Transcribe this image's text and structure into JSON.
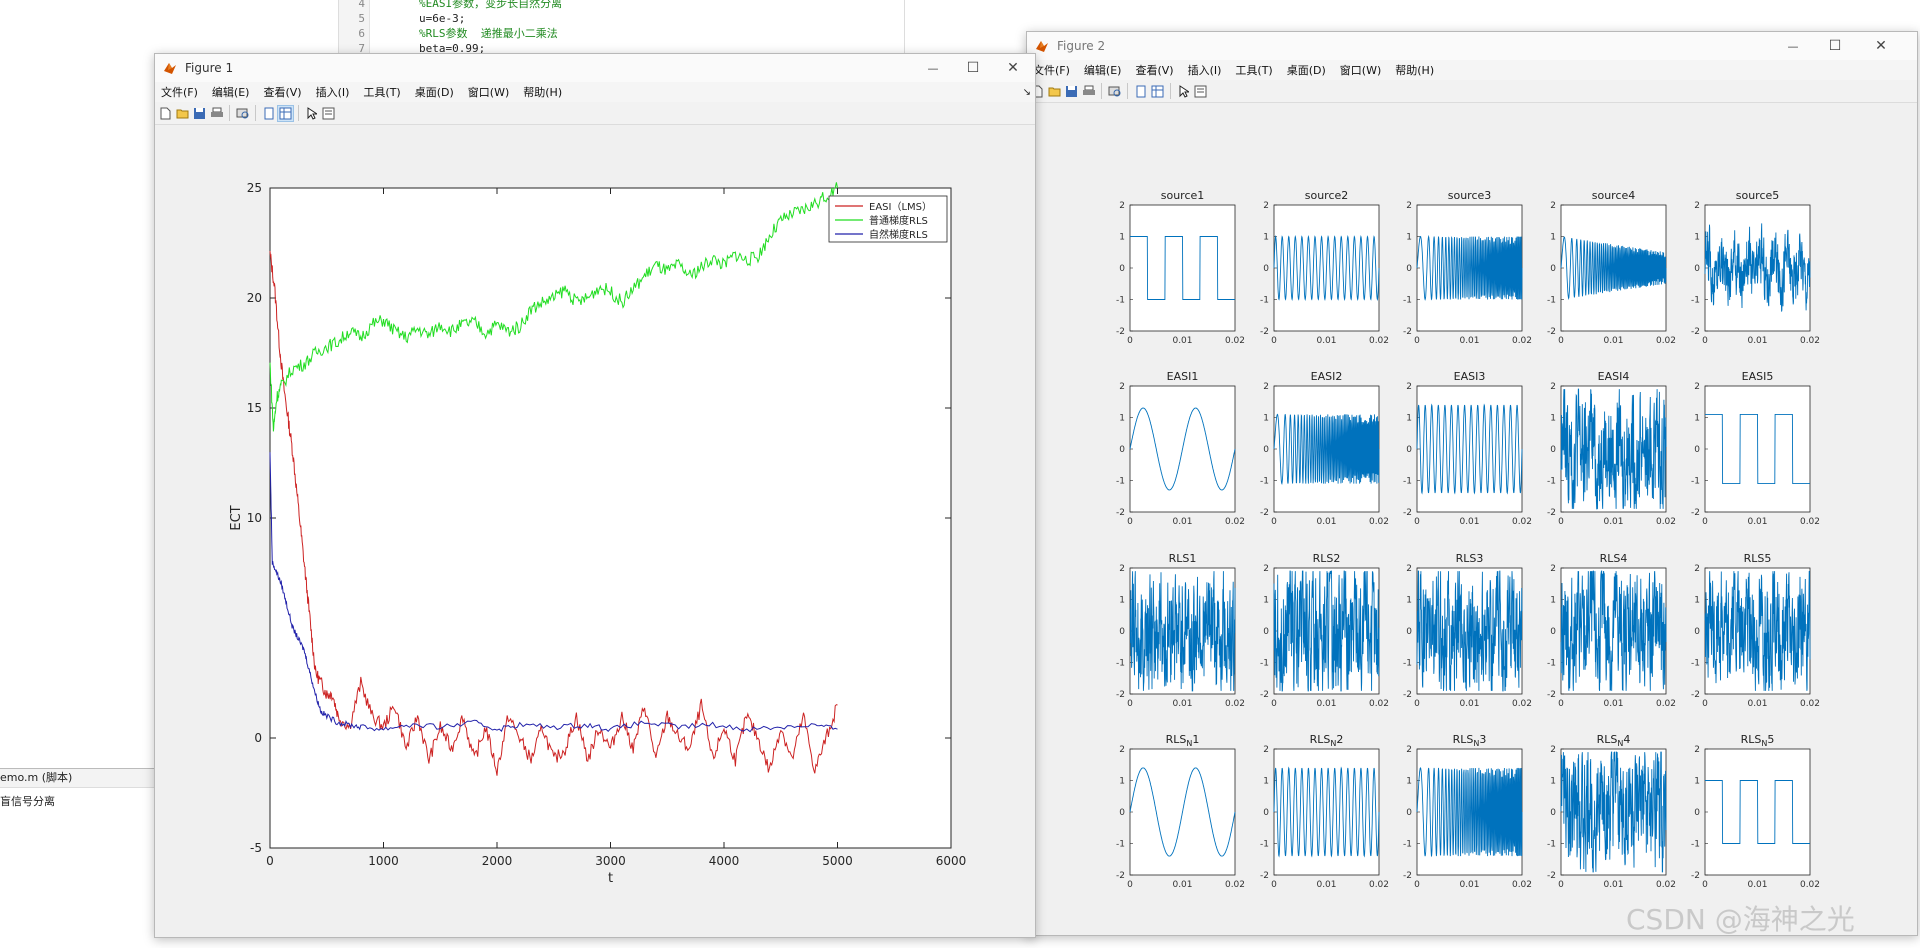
{
  "editor": {
    "lines": [
      {
        "num": "4",
        "text": "%EASI参数，变步长自然分离",
        "comment": true
      },
      {
        "num": "5",
        "text": "u=6e-3;",
        "comment": false
      },
      {
        "num": "6",
        "text": "%RLS参数  递推最小二乘法",
        "comment": true
      },
      {
        "num": "7",
        "text": "beta=0.99;",
        "comment": false
      }
    ]
  },
  "bg_script": {
    "tab_label": "emo.m  (脚本)",
    "text": "盲信号分离"
  },
  "figure1": {
    "title": "Figure 1",
    "menu": [
      "文件(F)",
      "编辑(E)",
      "查看(V)",
      "插入(I)",
      "工具(T)",
      "桌面(D)",
      "窗口(W)",
      "帮助(H)"
    ],
    "close": "✕",
    "maximize": "☐",
    "minimize": "—"
  },
  "figure2": {
    "title": "Figure 2",
    "menu": [
      "文件(F)",
      "编辑(E)",
      "查看(V)",
      "插入(I)",
      "工具(T)",
      "桌面(D)",
      "窗口(W)",
      "帮助(H)"
    ],
    "close": "✕",
    "maximize": "☐",
    "minimize": "—"
  },
  "chart_data": [
    {
      "type": "line",
      "xlabel": "t",
      "ylabel": "ECT",
      "xlim": [
        0,
        6000
      ],
      "ylim": [
        -5,
        25
      ],
      "xticks": [
        0,
        1000,
        2000,
        3000,
        4000,
        5000,
        6000
      ],
      "yticks": [
        -5,
        0,
        10,
        15,
        20,
        25
      ],
      "legend_position": "top-right",
      "series": [
        {
          "name": "EASI（LMS）",
          "color": "#cc2222",
          "x": [
            0,
            40,
            80,
            120,
            160,
            200,
            240,
            280,
            320,
            360,
            400,
            450,
            500,
            550,
            600,
            700,
            800,
            900,
            1000,
            1100,
            1200,
            1300,
            1400,
            1500,
            1600,
            1700,
            1800,
            1900,
            2000,
            2100,
            2200,
            2300,
            2400,
            2500,
            2600,
            2700,
            2800,
            2900,
            3000,
            3100,
            3200,
            3300,
            3400,
            3500,
            3600,
            3700,
            3800,
            3900,
            4000,
            4100,
            4200,
            4300,
            4400,
            4500,
            4600,
            4700,
            4800,
            4900,
            5000
          ],
          "y": [
            22,
            20.5,
            18,
            16,
            14.5,
            13,
            11,
            9,
            7,
            5,
            3,
            2.5,
            2,
            2,
            1,
            0.5,
            2.5,
            1,
            0.5,
            1.5,
            -0.5,
            1,
            -1,
            0.5,
            -0.5,
            1,
            -1,
            0.5,
            -1.5,
            1,
            0,
            -1,
            0.5,
            -1,
            -0.5,
            1,
            -1,
            0.5,
            -0.5,
            1,
            -0.5,
            1.5,
            -1,
            1,
            0,
            -0.5,
            1.5,
            -1,
            0.5,
            -1,
            1,
            0,
            -1.5,
            0.5,
            -1,
            1,
            -1.5,
            0,
            1.5
          ]
        },
        {
          "name": "普通梯度RLS",
          "color": "#22dd22",
          "x": [
            0,
            30,
            60,
            100,
            200,
            300,
            400,
            500,
            600,
            700,
            800,
            900,
            1000,
            1100,
            1200,
            1300,
            1400,
            1500,
            1600,
            1700,
            1800,
            1900,
            2000,
            2100,
            2200,
            2300,
            2400,
            2500,
            2600,
            2700,
            2800,
            2900,
            3000,
            3100,
            3200,
            3300,
            3400,
            3500,
            3600,
            3700,
            3800,
            3900,
            4000,
            4100,
            4200,
            4300,
            4400,
            4500,
            4600,
            4700,
            4800,
            4900,
            5000
          ],
          "y": [
            17,
            14,
            15.5,
            16,
            16.8,
            17,
            17.5,
            17.8,
            18,
            18.5,
            18.2,
            18.8,
            19,
            18.5,
            18.2,
            18.6,
            18.3,
            18.8,
            18.5,
            18.8,
            18.9,
            18.4,
            18.8,
            18.5,
            18.7,
            19.5,
            19.8,
            20,
            20.4,
            19.8,
            20,
            20.5,
            20.3,
            19.8,
            20.4,
            21,
            21.5,
            21.2,
            21.5,
            21,
            21.4,
            21.8,
            21.5,
            22,
            21.7,
            21.9,
            22.8,
            23.5,
            23.8,
            24,
            24.3,
            24.6,
            25
          ]
        },
        {
          "name": "自然梯度RLS",
          "color": "#2222aa",
          "x": [
            0,
            20,
            60,
            100,
            150,
            200,
            250,
            300,
            350,
            400,
            450,
            500,
            600,
            700,
            800,
            1000,
            1200,
            1500,
            1800,
            2000,
            2200,
            2500,
            2800,
            3000,
            3300,
            3600,
            3900,
            4200,
            4500,
            4800,
            5000
          ],
          "y": [
            13,
            8,
            7.5,
            7,
            6,
            5,
            4.5,
            4,
            3,
            2,
            1.2,
            1,
            0.7,
            0.6,
            0.5,
            0.4,
            0.6,
            0.5,
            0.7,
            0.4,
            0.6,
            0.5,
            0.6,
            0.4,
            0.7,
            0.5,
            0.6,
            0.4,
            0.5,
            0.6,
            0.4
          ]
        }
      ]
    },
    {
      "type": "line",
      "grid_rows": 4,
      "grid_cols": 5,
      "xlim": [
        0,
        0.02
      ],
      "ylim": [
        -2,
        2
      ],
      "xticks": [
        "0",
        "0.01",
        "0.02"
      ],
      "yticks": [
        "2",
        "1",
        "0",
        "-1",
        "-2"
      ],
      "panels": [
        {
          "title": "source1",
          "kind": "square",
          "freq": 3,
          "amp": 1
        },
        {
          "title": "source2",
          "kind": "sine",
          "freq": 16,
          "amp": 1
        },
        {
          "title": "source3",
          "kind": "chirp",
          "freq": 8,
          "amp": 1
        },
        {
          "title": "source4",
          "kind": "chirp_fade",
          "freq": 10,
          "amp": 1
        },
        {
          "title": "source5",
          "kind": "noise",
          "freq": 0,
          "amp": 0.8
        },
        {
          "title": "EASI1",
          "kind": "sine",
          "freq": 2,
          "amp": 1.3
        },
        {
          "title": "EASI2",
          "kind": "chirp",
          "freq": 9,
          "amp": 1.1
        },
        {
          "title": "EASI3",
          "kind": "sine",
          "freq": 16,
          "amp": 1.4
        },
        {
          "title": "EASI4",
          "kind": "noise",
          "freq": 0,
          "amp": 1.5
        },
        {
          "title": "EASI5",
          "kind": "square",
          "freq": 3,
          "amp": 1.1
        },
        {
          "title": "RLS1",
          "kind": "noise",
          "freq": 0,
          "amp": 1.6
        },
        {
          "title": "RLS2",
          "kind": "noise",
          "freq": 0,
          "amp": 1.7
        },
        {
          "title": "RLS3",
          "kind": "noise",
          "freq": 0,
          "amp": 1.6
        },
        {
          "title": "RLS4",
          "kind": "noise",
          "freq": 0,
          "amp": 1.6
        },
        {
          "title": "RLS5",
          "kind": "noise",
          "freq": 0,
          "amp": 1.5
        },
        {
          "title": "RLS_N1",
          "kind": "sine",
          "freq": 2,
          "amp": 1.4
        },
        {
          "title": "RLS_N2",
          "kind": "sine",
          "freq": 16,
          "amp": 1.4
        },
        {
          "title": "RLS_N3",
          "kind": "chirp",
          "freq": 8,
          "amp": 1.4
        },
        {
          "title": "RLS_N4",
          "kind": "noise",
          "freq": 0,
          "amp": 1.6
        },
        {
          "title": "RLS_N5",
          "kind": "square",
          "freq": 3,
          "amp": 1
        }
      ]
    }
  ],
  "watermark": "CSDN @海神之光"
}
